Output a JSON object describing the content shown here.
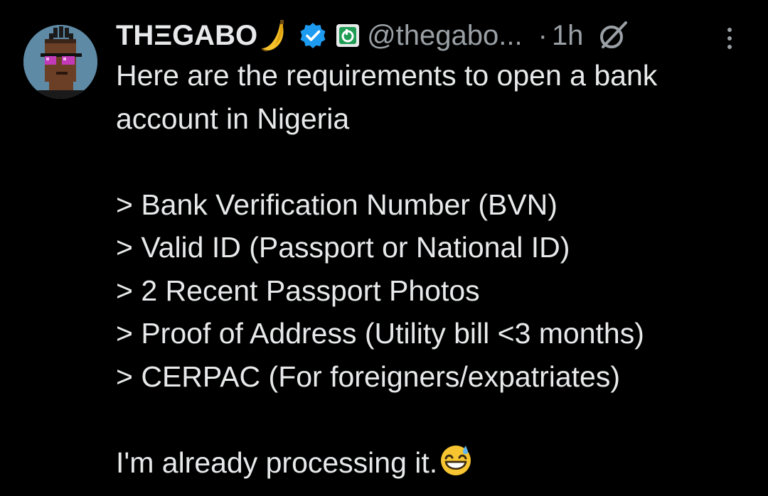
{
  "tweet": {
    "author": {
      "display_name": "THΞGABO",
      "name_emoji": "banana",
      "verified_badge": "verified-checkmark-icon",
      "affiliate_badge": "affiliate-badge-icon",
      "handle": "@thegabo...",
      "avatar": "pixel-art-avatar"
    },
    "separator": "·",
    "timestamp": "1h",
    "header_icons": [
      "grok-icon",
      "more-options-icon"
    ],
    "text": {
      "line_1": "Here are the requirements to open a bank",
      "line_2": "account in Nigeria",
      "requirements": [
        "> Bank Verification Number (BVN)",
        "> Valid ID (Passport or National ID)",
        "> 2 Recent Passport Photos",
        "> Proof of Address (Utility bill <3 months)",
        "> CERPAC (For foreigners/expatriates)"
      ],
      "closing": "I'm already processing it.",
      "closing_emoji": "grinning-face-with-sweat"
    },
    "colors": {
      "background": "#000000",
      "primary_text": "#e7e9ea",
      "secondary_text": "#9aa0a5",
      "verified_blue": "#1d9bf0",
      "affiliate_green": "#1f9d55"
    }
  }
}
